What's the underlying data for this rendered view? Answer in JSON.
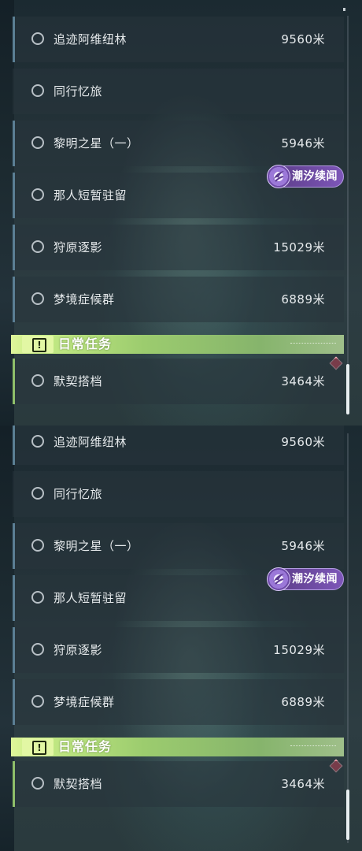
{
  "panels": [
    {
      "quests": [
        {
          "name": "追迹阿维纽林",
          "distance": "9560米"
        },
        {
          "name": "同行忆旅",
          "distance": ""
        },
        {
          "name": "黎明之星（一）",
          "distance": "5946米"
        },
        {
          "name": "那人短暂驻留",
          "distance": ""
        },
        {
          "name": "狩原逐影",
          "distance": "15029米"
        },
        {
          "name": "梦境症候群",
          "distance": "6889米"
        }
      ],
      "tag": {
        "label": "潮汐续闻",
        "icon": "tide-story-icon"
      },
      "daily_section": {
        "title": "日常任务",
        "icon": "exclamation-box-icon"
      },
      "daily_quests": [
        {
          "name": "默契搭档",
          "distance": "3464米"
        }
      ]
    },
    {
      "quests": [
        {
          "name": "追迹阿维纽林",
          "distance": "9560米"
        },
        {
          "name": "同行忆旅",
          "distance": ""
        },
        {
          "name": "黎明之星（一）",
          "distance": "5946米"
        },
        {
          "name": "那人短暂驻留",
          "distance": ""
        },
        {
          "name": "狩原逐影",
          "distance": "15029米"
        },
        {
          "name": "梦境症候群",
          "distance": "6889米"
        }
      ],
      "tag": {
        "label": "潮汐续闻",
        "icon": "tide-story-icon"
      },
      "daily_section": {
        "title": "日常任务",
        "icon": "exclamation-box-icon"
      },
      "daily_quests": [
        {
          "name": "默契搭档",
          "distance": "3464米"
        }
      ]
    }
  ],
  "colors": {
    "quest_edge": "#5b7f94",
    "daily_accent": "#9ccc6e",
    "tag_purple": "#7d56b8",
    "alert_diamond": "#d9465c"
  }
}
